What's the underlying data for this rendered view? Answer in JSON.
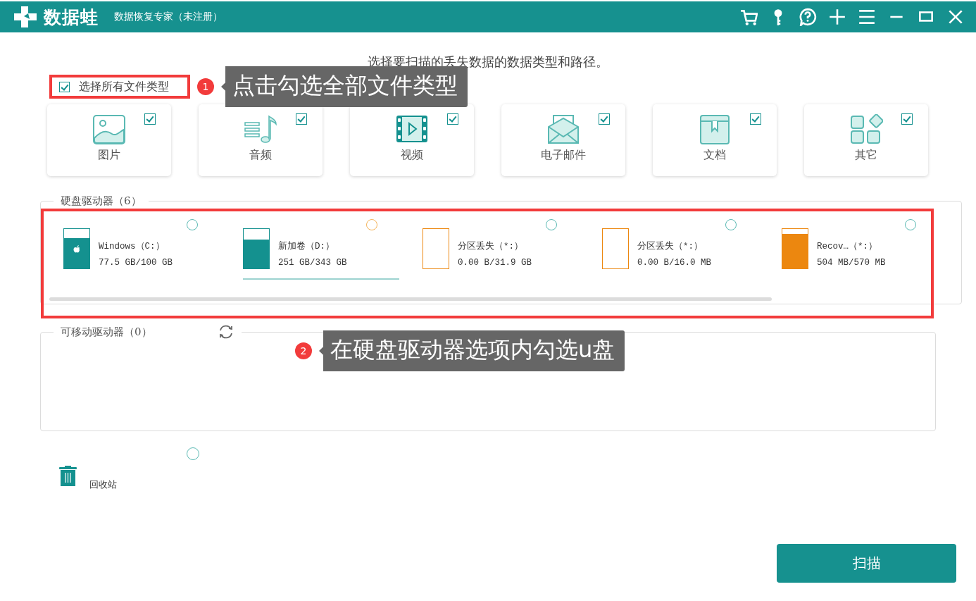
{
  "window": {
    "logo_text": "数据蛙",
    "title": "数据恢复专家（未注册）"
  },
  "instruction": "选择要扫描的丢失数据的数据类型和路径。",
  "select_all": {
    "label": "选择所有文件类型",
    "checked": true
  },
  "file_types": [
    {
      "kind": "image",
      "label": "图片",
      "checked": true
    },
    {
      "kind": "audio",
      "label": "音频",
      "checked": true
    },
    {
      "kind": "video",
      "label": "视频",
      "checked": true
    },
    {
      "kind": "email",
      "label": "电子邮件",
      "checked": true
    },
    {
      "kind": "document",
      "label": "文档",
      "checked": true
    },
    {
      "kind": "other",
      "label": "其它",
      "checked": true
    }
  ],
  "hard_drives": {
    "title": "硬盘驱动器（6）",
    "drives": [
      {
        "kind": "system",
        "name": "Windows（C:）",
        "size": "77.5 GB/100 GB",
        "level": 0.775,
        "color": "#14918f",
        "selected": false,
        "hovered": false
      },
      {
        "kind": "volume",
        "name": "新加卷（D:）",
        "size": "251 GB/343 GB",
        "level": 0.73,
        "color": "#14918f",
        "selected": false,
        "hovered": true
      },
      {
        "kind": "volume",
        "name": "分区丢失（*:）",
        "size": "0.00 B/31.9 GB",
        "level": 0,
        "color": "#ec870f",
        "selected": false,
        "hovered": false
      },
      {
        "kind": "volume",
        "name": "分区丢失（*:）",
        "size": "0.00 B/16.0 MB",
        "level": 0,
        "color": "#ec870f",
        "selected": false,
        "hovered": false
      },
      {
        "kind": "volume",
        "name": "Recov…（*:）",
        "size": "504 MB/570 MB",
        "level": 0.88,
        "color": "#ec870f",
        "selected": false,
        "hovered": false
      }
    ]
  },
  "removable": {
    "title": "可移动驱动器（0）"
  },
  "recycle_bin": {
    "label": "回收站",
    "selected": false
  },
  "scan_button": "扫描",
  "annotations": [
    {
      "number": "1",
      "text": "点击勾选全部文件类型"
    },
    {
      "number": "2",
      "text": "在硬盘驱动器选项内勾选u盘"
    }
  ]
}
